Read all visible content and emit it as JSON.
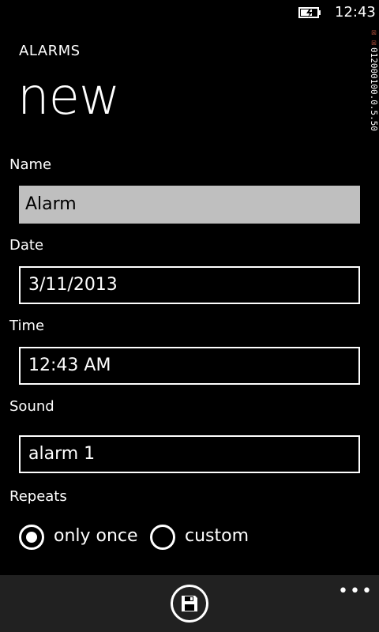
{
  "status": {
    "time": "12:43",
    "icons": [
      "battery-charging-icon"
    ]
  },
  "debug_text": [
    "☒",
    "☒",
    "0",
    "1",
    "2",
    "0",
    "0",
    "0",
    "1",
    "0",
    "0",
    ".",
    "0",
    ".",
    "5",
    ".",
    "5",
    "0"
  ],
  "header": {
    "app_title": "ALARMS",
    "page_title": "new"
  },
  "form": {
    "name_label": "Name",
    "name_value": "Alarm",
    "date_label": "Date",
    "date_value": "3/11/2013",
    "time_label": "Time",
    "time_value": "12:43 AM",
    "sound_label": "Sound",
    "sound_value": "alarm 1",
    "repeats_label": "Repeats",
    "repeat_options": [
      {
        "label": "only once",
        "selected": true
      },
      {
        "label": "custom",
        "selected": false
      }
    ]
  },
  "app_bar": {
    "save_icon": "save-icon",
    "more_label": "•••"
  },
  "colors": {
    "background": "#000000",
    "app_bar": "#212121",
    "active_field": "#bfbfbf",
    "debug_accent": "#e0644a"
  }
}
